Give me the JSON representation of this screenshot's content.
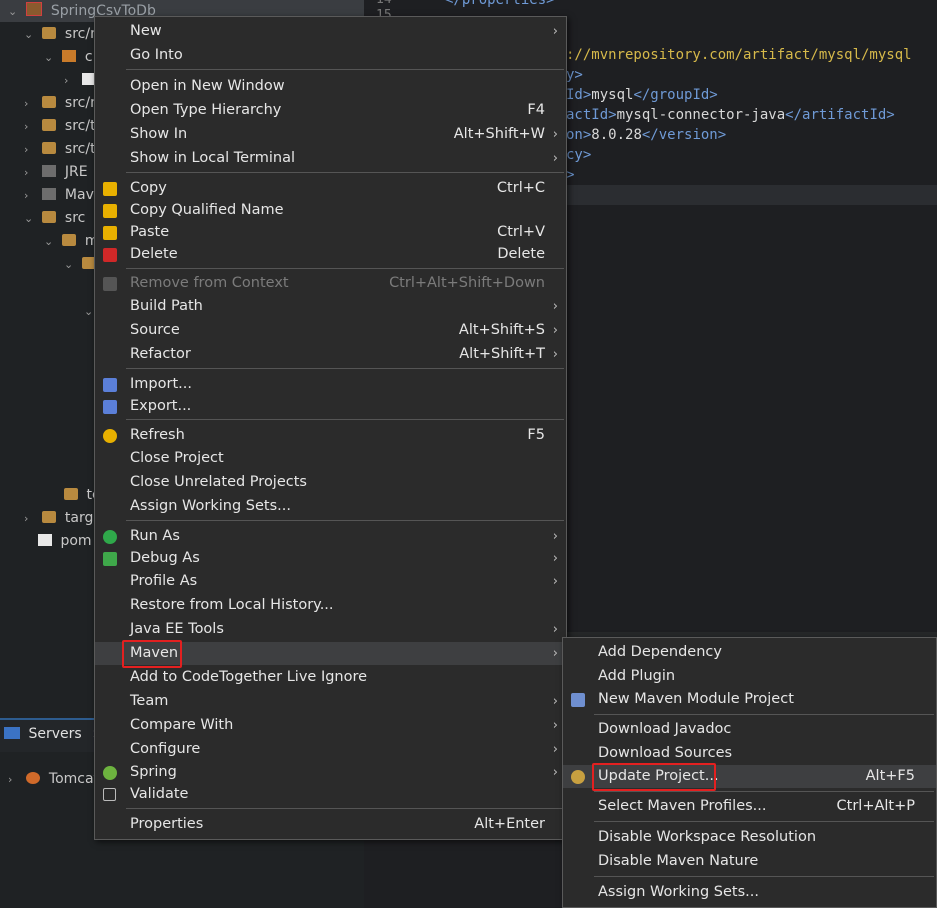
{
  "explorer": {
    "rows": [
      {
        "label": "SpringCsvToDb",
        "arrow": "⌄"
      },
      {
        "label": "src/m",
        "arrow": "⌄"
      },
      {
        "label": "c",
        "arrow": "⌄"
      },
      {
        "label": "",
        "arrow": "›"
      },
      {
        "label": "src/m",
        "arrow": "›"
      },
      {
        "label": "src/t",
        "arrow": "›"
      },
      {
        "label": "src/t",
        "arrow": "›"
      },
      {
        "label": "JRE",
        "arrow": "›"
      },
      {
        "label": "Mav",
        "arrow": "›"
      },
      {
        "label": "src",
        "arrow": "⌄"
      },
      {
        "label": "m",
        "arrow": "⌄"
      },
      {
        "label": "",
        "arrow": "⌄"
      },
      {
        "label": "",
        "arrow": "⌄"
      },
      {
        "label": "te",
        "arrow": ""
      },
      {
        "label": "targ",
        "arrow": "›"
      },
      {
        "label": "pom",
        "arrow": ""
      }
    ]
  },
  "servers": {
    "tab_label": "Servers",
    "close": "✕",
    "item": "Tomcat",
    "item_arrow": "›"
  },
  "editor": {
    "gutter": [
      "14",
      "15"
    ],
    "lines": [
      {
        "parts": [
          [
            "c-tag",
            "</properties>"
          ]
        ]
      },
      {
        "parts": [
          [
            "c-url",
            "://mvnrepository.com/artifact/mysql/mysql"
          ]
        ]
      },
      {
        "parts": [
          [
            "c-tag",
            "y>"
          ]
        ]
      },
      {
        "parts": [
          [
            "c-tag",
            "Id>"
          ],
          [
            "c-txt",
            "mysql"
          ],
          [
            "c-tag",
            "</groupId>"
          ]
        ]
      },
      {
        "parts": [
          [
            "c-tag",
            "actId>"
          ],
          [
            "c-txt",
            "mysql-connector-java"
          ],
          [
            "c-tag",
            "</artifactId>"
          ]
        ]
      },
      {
        "parts": [
          [
            "c-tag",
            "on>"
          ],
          [
            "c-txt",
            "8.0.28"
          ],
          [
            "c-tag",
            "</version>"
          ]
        ]
      },
      {
        "parts": [
          [
            "c-tag",
            "cy>"
          ]
        ]
      },
      {
        "parts": [
          [
            "c-tag",
            ">"
          ]
        ]
      }
    ]
  },
  "context_menu": {
    "items": [
      {
        "label": "New",
        "sub": "›"
      },
      {
        "label": "Go Into"
      },
      {
        "label": "Open in New Window"
      },
      {
        "label": "Open Type Hierarchy",
        "acc": "F4"
      },
      {
        "label": "Show In",
        "acc": "Alt+Shift+W",
        "sub": "›"
      },
      {
        "label": "Show in Local Terminal",
        "sub": "›"
      },
      {
        "label": "Copy",
        "acc": "Ctrl+C"
      },
      {
        "label": "Copy Qualified Name"
      },
      {
        "label": "Paste",
        "acc": "Ctrl+V"
      },
      {
        "label": "Delete",
        "acc": "Delete"
      },
      {
        "label": "Remove from Context",
        "acc": "Ctrl+Alt+Shift+Down"
      },
      {
        "label": "Build Path",
        "sub": "›"
      },
      {
        "label": "Source",
        "acc": "Alt+Shift+S",
        "sub": "›"
      },
      {
        "label": "Refactor",
        "acc": "Alt+Shift+T",
        "sub": "›"
      },
      {
        "label": "Import..."
      },
      {
        "label": "Export..."
      },
      {
        "label": "Refresh",
        "acc": "F5"
      },
      {
        "label": "Close Project"
      },
      {
        "label": "Close Unrelated Projects"
      },
      {
        "label": "Assign Working Sets..."
      },
      {
        "label": "Run As",
        "sub": "›"
      },
      {
        "label": "Debug As",
        "sub": "›"
      },
      {
        "label": "Profile As",
        "sub": "›"
      },
      {
        "label": "Restore from Local History..."
      },
      {
        "label": "Java EE Tools",
        "sub": "›"
      },
      {
        "label": "Maven",
        "sub": "›"
      },
      {
        "label": "Add to CodeTogether Live Ignore"
      },
      {
        "label": "Team",
        "sub": "›"
      },
      {
        "label": "Compare With",
        "sub": "›"
      },
      {
        "label": "Configure",
        "sub": "›"
      },
      {
        "label": "Spring",
        "sub": "›"
      },
      {
        "label": "Validate"
      },
      {
        "label": "Properties",
        "acc": "Alt+Enter"
      }
    ]
  },
  "maven_menu": {
    "items": [
      {
        "label": "Add Dependency"
      },
      {
        "label": "Add Plugin"
      },
      {
        "label": "New Maven Module Project"
      },
      {
        "label": "Download Javadoc"
      },
      {
        "label": "Download Sources"
      },
      {
        "label": "Update Project...",
        "acc": "Alt+F5"
      },
      {
        "label": "Select Maven Profiles...",
        "acc": "Ctrl+Alt+P"
      },
      {
        "label": "Disable Workspace Resolution"
      },
      {
        "label": "Disable Maven Nature"
      },
      {
        "label": "Assign Working Sets..."
      }
    ]
  }
}
